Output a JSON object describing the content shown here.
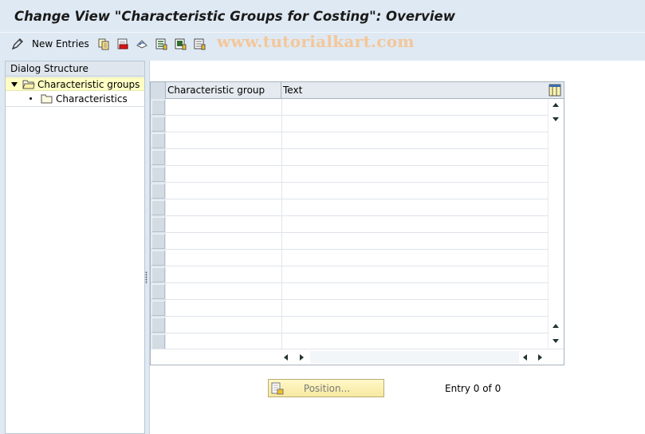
{
  "window": {
    "title": "Change View \"Characteristic Groups for Costing\": Overview",
    "watermark": "www.tutorialkart.com"
  },
  "toolbar": {
    "new_entries_label": "New Entries",
    "icons": [
      "display-change-icon",
      "copy-as-icon",
      "delete-icon",
      "undo-change-icon",
      "select-all-icon",
      "select-block-icon",
      "deselect-all-icon"
    ]
  },
  "dialog_structure": {
    "header": "Dialog Structure",
    "items": [
      {
        "label": "Characteristic groups",
        "level": 1,
        "expanded": true,
        "selected": true
      },
      {
        "label": "Characteristics",
        "level": 2,
        "expanded": false,
        "selected": false
      }
    ]
  },
  "table": {
    "columns": [
      "Characteristic group",
      "Text"
    ],
    "rows": []
  },
  "footer": {
    "position_button": "Position...",
    "entry_info": "Entry 0 of 0"
  },
  "colors": {
    "background": "#dfe9f3",
    "selected_tree_row": "#ffffc4",
    "position_button": "#f7e9a0",
    "watermark": "#f3c79a"
  }
}
